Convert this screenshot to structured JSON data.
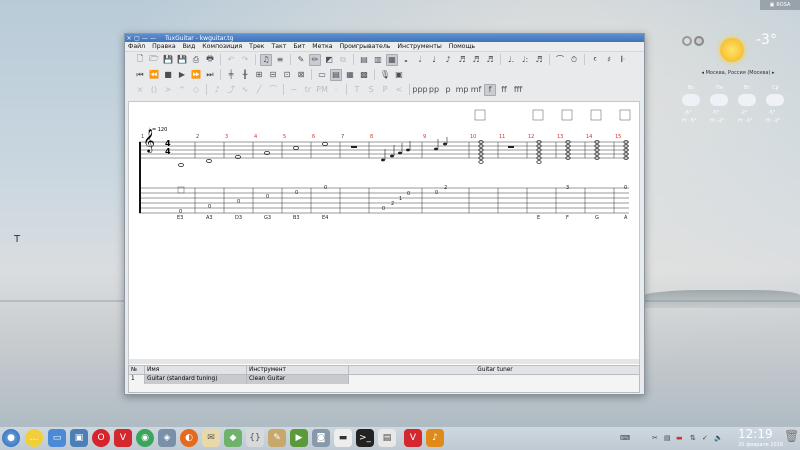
{
  "window": {
    "title": "TuxGuitar - kwguitar.tg",
    "controls": [
      "×",
      "▢",
      "—",
      "—"
    ]
  },
  "menu": [
    "Файл",
    "Правка",
    "Вид",
    "Композиция",
    "Трек",
    "Такт",
    "Бит",
    "Метка",
    "Проигрыватель",
    "Инструменты",
    "Помощь"
  ],
  "score": {
    "tempo": "= 120",
    "time_signature": [
      "4",
      "4"
    ],
    "measure_numbers": [
      "1",
      "2",
      "3",
      "4",
      "5",
      "6",
      "7",
      "8",
      "9",
      "10",
      "11",
      "12",
      "13",
      "14",
      "15"
    ],
    "tab_numbers": [
      "0",
      "0",
      "0",
      "0",
      "0",
      "0",
      "0",
      "2",
      "1",
      "0",
      "0",
      "2",
      "3",
      "0"
    ],
    "note_names": [
      "E3",
      "A3",
      "D3",
      "G3",
      "B3",
      "E4",
      "E",
      "F",
      "G",
      "A"
    ]
  },
  "track_table": {
    "headers": [
      "№",
      "Имя",
      "Инструмент",
      "Guitar tuner"
    ],
    "rows": [
      {
        "no": "1",
        "name": "Guitar (standard tuning)",
        "instrument": "Clean Guitar"
      }
    ]
  },
  "weather": {
    "temp": "-3°",
    "location": "Москва, Россия (Москва)",
    "days": [
      "Вс",
      "Пн",
      "Вт",
      "Ср"
    ],
    "lows": [
      "-6°",
      "-5°",
      "-2°",
      "-5°"
    ],
    "highs": [
      "H: -5°",
      "H: -2°",
      "H: -1°",
      "H: -2°"
    ]
  },
  "taskbar": {
    "time": "12:19",
    "date": "20 февраля 2016",
    "rosa_label": "ROSA"
  },
  "colors": {
    "accent": "#3e73ba",
    "measure_number": "#d03030"
  }
}
